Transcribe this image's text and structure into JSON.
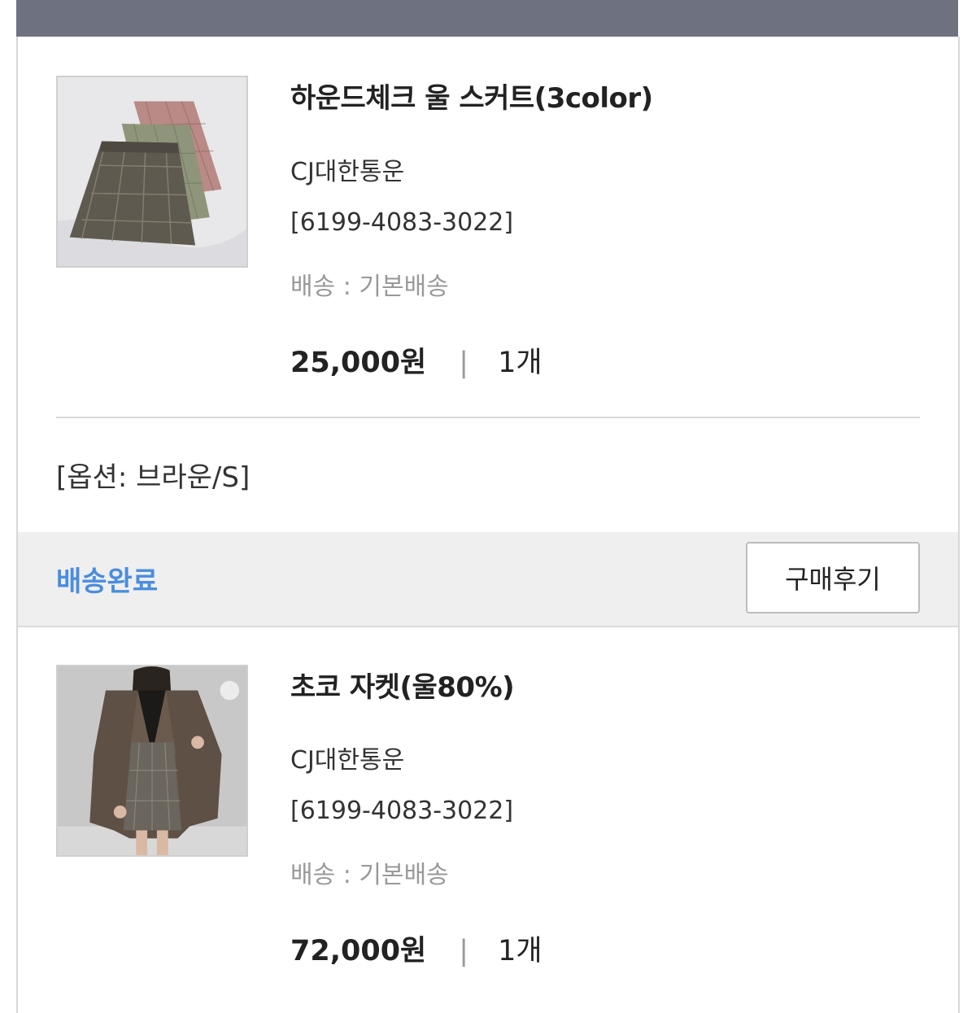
{
  "orders": [
    {
      "title": "하운드체크 울 스커트(3color)",
      "carrier": "CJ대한통운",
      "tracking": "[6199-4083-3022]",
      "shipping": "배송 : 기본배송",
      "price": "25,000원",
      "separator": "|",
      "quantity": "1개",
      "option": "[옵션: 브라운/S]",
      "status": "배송완료",
      "review_label": "구매후기",
      "image": "skirt-product-photo"
    },
    {
      "title": "초코 자켓(울80%)",
      "carrier": "CJ대한통운",
      "tracking": "[6199-4083-3022]",
      "shipping": "배송 : 기본배송",
      "price": "72,000원",
      "separator": "|",
      "quantity": "1개",
      "image": "jacket-product-photo"
    }
  ],
  "colors": {
    "topbar": "#6d7180",
    "status": "#4a8de0",
    "status_bar_bg": "#efefef"
  }
}
